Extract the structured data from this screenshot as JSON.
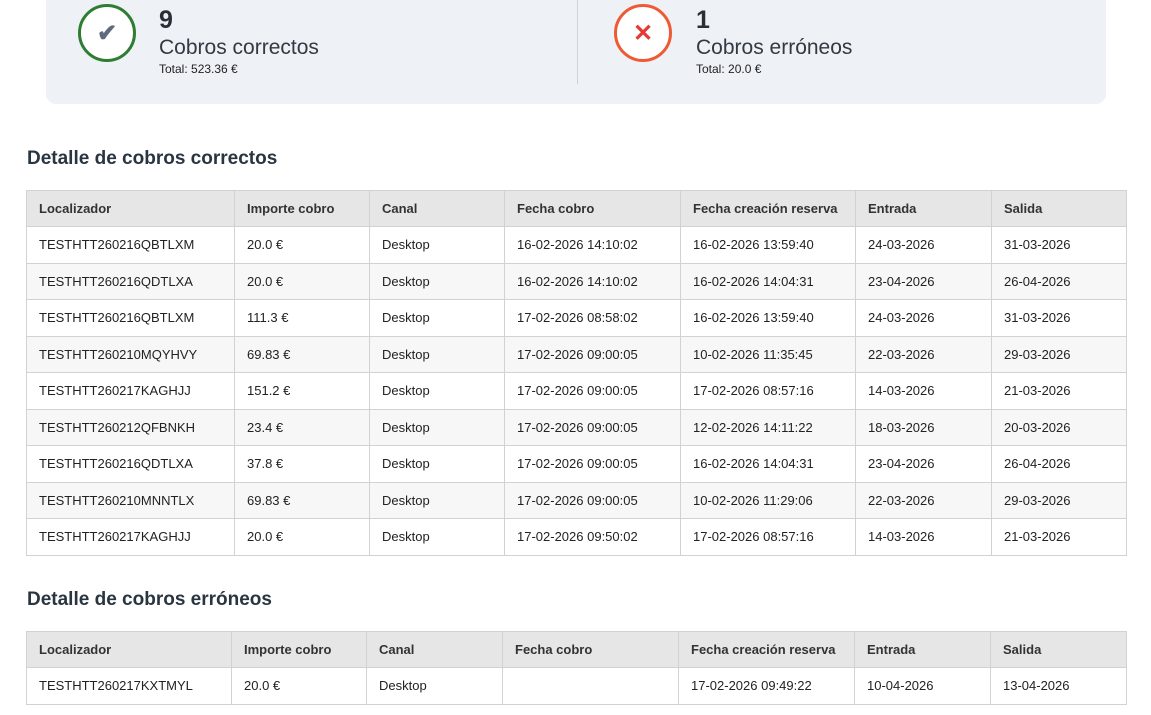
{
  "summary": {
    "ok": {
      "count": "9",
      "label": "Cobros correctos",
      "total": "Total: 523.36 €",
      "icon": "✔"
    },
    "err": {
      "count": "1",
      "label": "Cobros erróneos",
      "total": "Total: 20.0 €",
      "icon": "✕"
    }
  },
  "correct": {
    "title": "Detalle de cobros correctos",
    "headers": [
      "Localizador",
      "Importe cobro",
      "Canal",
      "Fecha cobro",
      "Fecha creación reserva",
      "Entrada",
      "Salida"
    ],
    "rows": [
      [
        "TESTHTT260216QBTLXM",
        "20.0 €",
        "Desktop",
        "16-02-2026 14:10:02",
        "16-02-2026 13:59:40",
        "24-03-2026",
        "31-03-2026"
      ],
      [
        "TESTHTT260216QDTLXA",
        "20.0 €",
        "Desktop",
        "16-02-2026 14:10:02",
        "16-02-2026 14:04:31",
        "23-04-2026",
        "26-04-2026"
      ],
      [
        "TESTHTT260216QBTLXM",
        "111.3 €",
        "Desktop",
        "17-02-2026 08:58:02",
        "16-02-2026 13:59:40",
        "24-03-2026",
        "31-03-2026"
      ],
      [
        "TESTHTT260210MQYHVY",
        "69.83 €",
        "Desktop",
        "17-02-2026 09:00:05",
        "10-02-2026 11:35:45",
        "22-03-2026",
        "29-03-2026"
      ],
      [
        "TESTHTT260217KAGHJJ",
        "151.2 €",
        "Desktop",
        "17-02-2026 09:00:05",
        "17-02-2026 08:57:16",
        "14-03-2026",
        "21-03-2026"
      ],
      [
        "TESTHTT260212QFBNKH",
        "23.4 €",
        "Desktop",
        "17-02-2026 09:00:05",
        "12-02-2026 14:11:22",
        "18-03-2026",
        "20-03-2026"
      ],
      [
        "TESTHTT260216QDTLXA",
        "37.8 €",
        "Desktop",
        "17-02-2026 09:00:05",
        "16-02-2026 14:04:31",
        "23-04-2026",
        "26-04-2026"
      ],
      [
        "TESTHTT260210MNNTLX",
        "69.83 €",
        "Desktop",
        "17-02-2026 09:00:05",
        "10-02-2026 11:29:06",
        "22-03-2026",
        "29-03-2026"
      ],
      [
        "TESTHTT260217KAGHJJ",
        "20.0 €",
        "Desktop",
        "17-02-2026 09:50:02",
        "17-02-2026 08:57:16",
        "14-03-2026",
        "21-03-2026"
      ]
    ]
  },
  "errors": {
    "title": "Detalle de cobros erróneos",
    "headers": [
      "Localizador",
      "Importe cobro",
      "Canal",
      "Fecha cobro",
      "Fecha creación reserva",
      "Entrada",
      "Salida"
    ],
    "rows": [
      [
        "TESTHTT260217KXTMYL",
        "20.0 €",
        "Desktop",
        "",
        "17-02-2026 09:49:22",
        "10-04-2026",
        "13-04-2026"
      ]
    ]
  }
}
